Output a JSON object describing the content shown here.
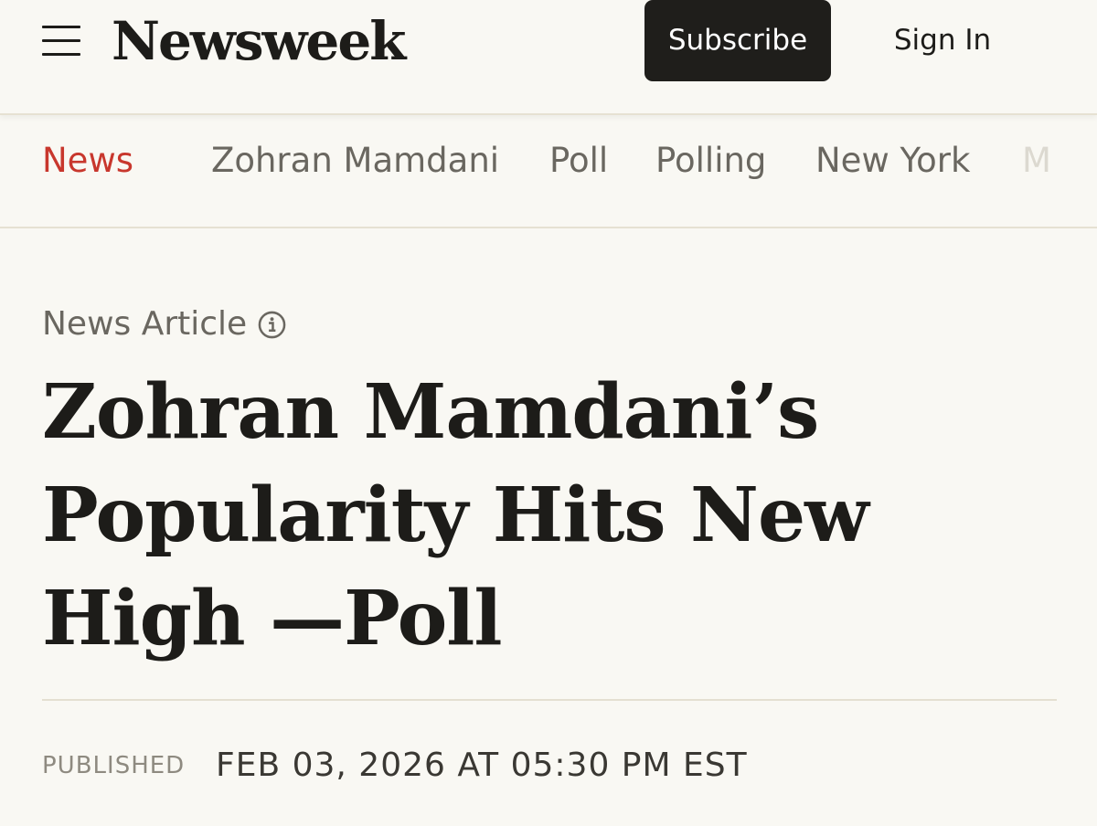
{
  "header": {
    "logo_text": "Newsweek",
    "subscribe_label": "Subscribe",
    "signin_label": "Sign In",
    "menu_icon": "hamburger-menu-icon"
  },
  "topic_nav": {
    "items": [
      {
        "label": "News",
        "active": true
      },
      {
        "label": "Zohran Mamdani",
        "active": false
      },
      {
        "label": "Poll",
        "active": false
      },
      {
        "label": "Polling",
        "active": false
      },
      {
        "label": "New York",
        "active": false
      },
      {
        "label": "M",
        "active": false,
        "truncated": true
      }
    ]
  },
  "article": {
    "type_label": "News Article",
    "info_icon": "info-icon",
    "headline": "Zohran Mamdani’s Popularity Hits New High —Poll",
    "published_label": "PUBLISHED",
    "published_date": "FEB 03, 2026 AT 05:30 PM EST"
  },
  "colors": {
    "background": "#f9f8f3",
    "accent_red": "#c8372d",
    "button_dark": "#1f1e1b",
    "text_dark": "#1d1c19",
    "text_muted": "#6a6760"
  }
}
